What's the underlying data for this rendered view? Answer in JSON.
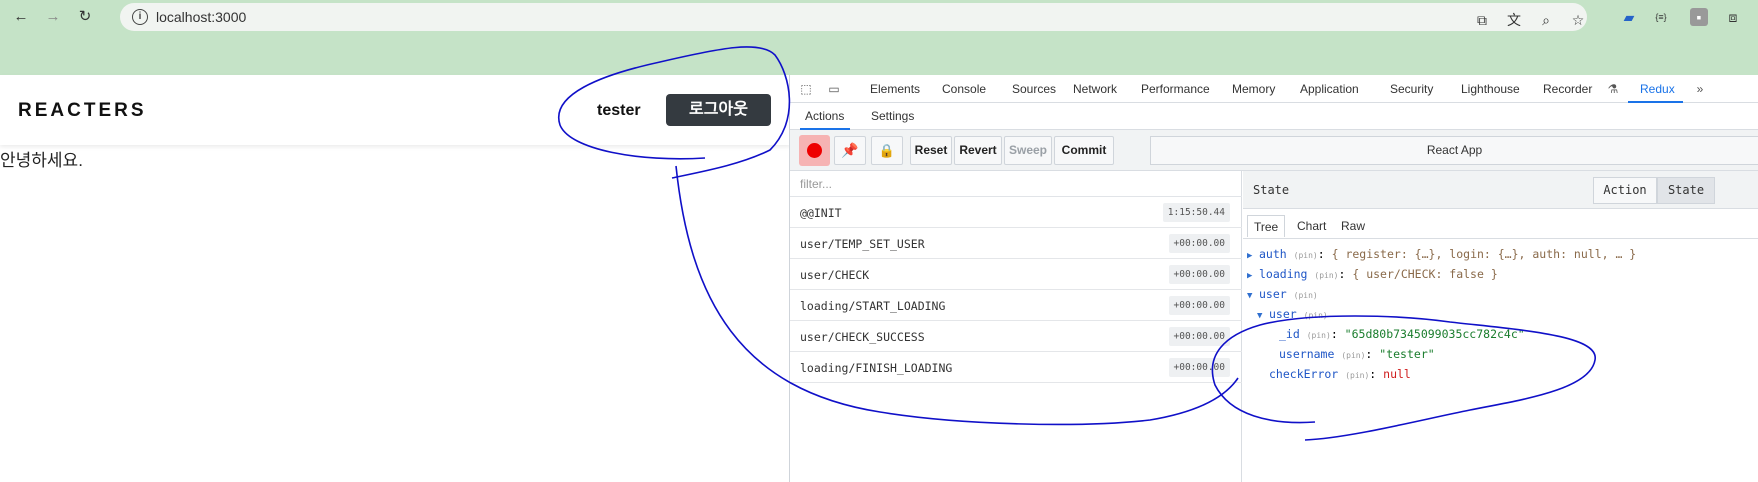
{
  "browser": {
    "url": "localhost:3000",
    "nav_icons": [
      "back-arrow-icon",
      "forward-arrow-icon",
      "reload-icon"
    ],
    "toolbar_icons": [
      "open-in-page-icon",
      "translate-icon",
      "zoom-icon",
      "bookmark-star-icon",
      "extension-icon",
      "extension-icon",
      "profile-icon",
      "puzzle-extensions-icon"
    ]
  },
  "app": {
    "logo": "REACTERS",
    "username": "tester",
    "logout_label": "로그아웃",
    "greeting": "안녕하세요."
  },
  "devtools": {
    "tabs": [
      "Elements",
      "Console",
      "Sources",
      "Network",
      "Performance",
      "Memory",
      "Application",
      "Security",
      "Lighthouse",
      "Recorder",
      "Redux"
    ],
    "active_tab": "Redux",
    "sub_tabs": [
      "Actions",
      "Settings"
    ],
    "toolbar": {
      "reset": "Reset",
      "revert": "Revert",
      "sweep": "Sweep",
      "commit": "Commit",
      "instance": "React App"
    },
    "filter_placeholder": "filter...",
    "actions": [
      {
        "name": "@@INIT",
        "time": "1:15:50.44"
      },
      {
        "name": "user/TEMP_SET_USER",
        "time": "+00:00.00"
      },
      {
        "name": "user/CHECK",
        "time": "+00:00.00"
      },
      {
        "name": "loading/START_LOADING",
        "time": "+00:00.00"
      },
      {
        "name": "user/CHECK_SUCCESS",
        "time": "+00:00.00"
      },
      {
        "name": "loading/FINISH_LOADING",
        "time": "+00:00.00"
      }
    ],
    "state": {
      "title": "State",
      "modes": [
        "Action",
        "State"
      ],
      "views": [
        "Tree",
        "Chart",
        "Raw"
      ],
      "pin": "(pin)",
      "tree": {
        "auth_key": "auth",
        "auth_val": "{ register: {…}, login: {…}, auth: null, … }",
        "loading_key": "loading",
        "loading_val": "{ user/CHECK: false }",
        "user_key": "user",
        "inner_user_key": "user",
        "id_key": "_id",
        "id_val": "\"65d80b7345099035cc782c4c\"",
        "username_key": "username",
        "username_val": "\"tester\"",
        "checkError_key": "checkError",
        "checkError_val": "null"
      }
    }
  },
  "colors": {
    "browser_green": "#c5e3c7",
    "annotation_blue": "#1010c8",
    "logout_bg": "#343a40",
    "redux_blue": "#1a73e8"
  }
}
